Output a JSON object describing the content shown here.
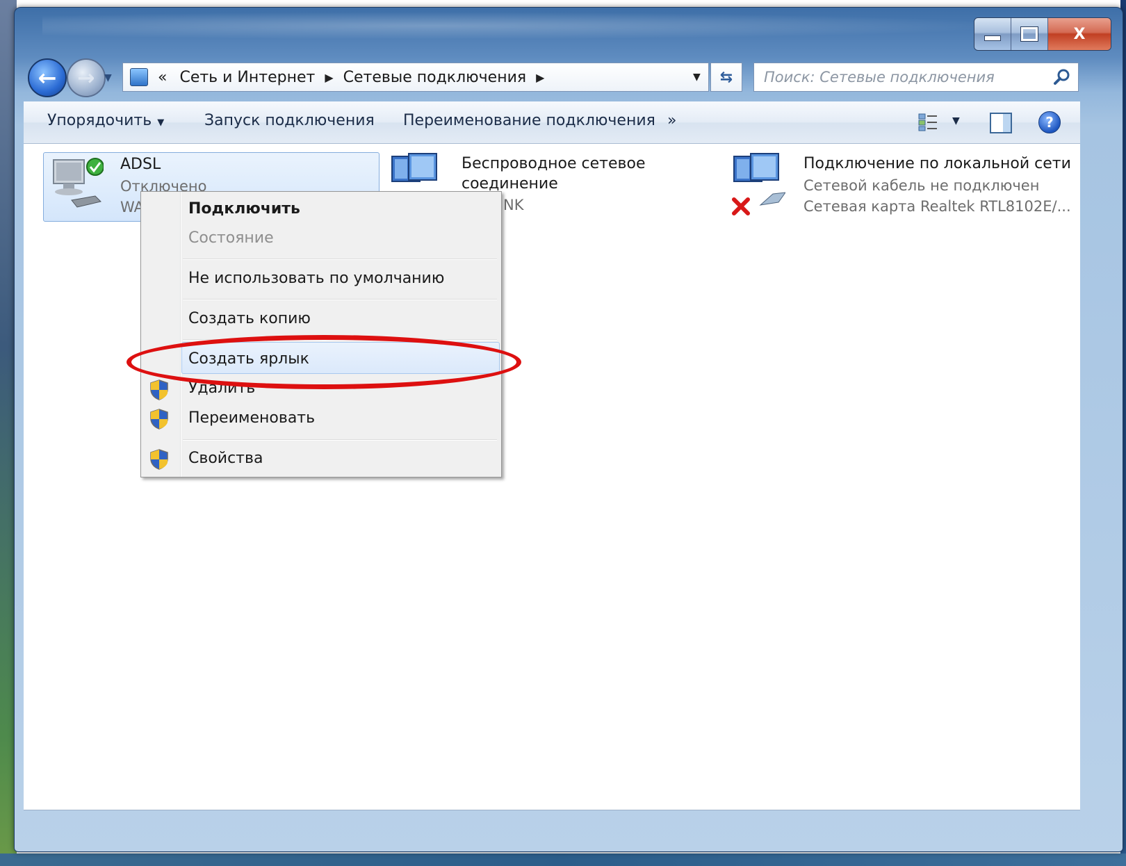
{
  "window": {
    "caption": {
      "minimize": "",
      "maximize": "",
      "close": "X"
    }
  },
  "nav": {
    "back_glyph": "←",
    "forward_glyph": "→",
    "breadcrumb": {
      "overflow": "«",
      "items": [
        "Сеть и Интернет",
        "Сетевые подключения"
      ],
      "separator": "▶"
    },
    "refresh_glyph": "⇆",
    "search_placeholder": "Поиск: Сетевые подключения"
  },
  "toolbar": {
    "organize": "Упорядочить",
    "start_connection": "Запуск подключения",
    "rename_connection": "Переименование подключения",
    "more": "»",
    "help": "?"
  },
  "connections": [
    {
      "name": "ADSL",
      "status": "Отключено",
      "device": "WA"
    },
    {
      "name_line1": "Беспроводное сетевое",
      "name_line2": "соединение",
      "device_tail": "NK"
    },
    {
      "name": "Подключение по локальной сети",
      "status": "Сетевой кабель не подключен",
      "device": "Сетевая карта Realtek RTL8102E/..."
    }
  ],
  "context_menu": {
    "items": [
      {
        "label": "Подключить",
        "bold": true
      },
      {
        "label": "Состояние",
        "disabled": true
      },
      {
        "label": "Не использовать по умолчанию"
      },
      {
        "label": "Создать копию"
      },
      {
        "label": "Создать ярлык",
        "highlighted": true
      },
      {
        "label": "Удалить",
        "shield": true
      },
      {
        "label": "Переименовать",
        "shield": true
      },
      {
        "label": "Свойства",
        "shield": true
      }
    ]
  },
  "colors": {
    "annotation": "#dd1010",
    "selection": "#d4e6fb",
    "accent": "#2b6bd4"
  }
}
